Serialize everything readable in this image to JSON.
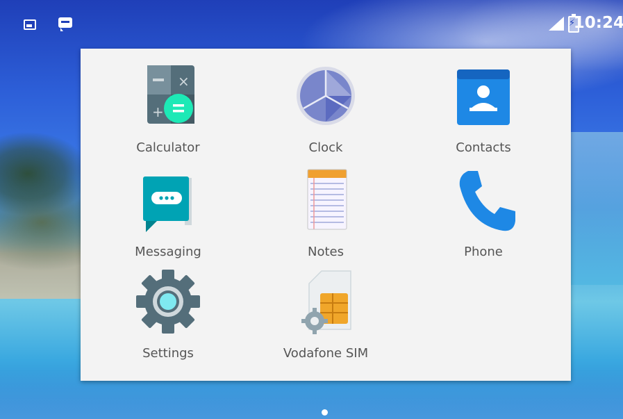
{
  "status_bar": {
    "time": "10:24",
    "icons": [
      "image-notification-icon",
      "message-notification-icon",
      "signal-icon",
      "battery-charging-icon"
    ]
  },
  "folder": {
    "apps": [
      {
        "label": "Calculator",
        "icon": "calculator-icon"
      },
      {
        "label": "Clock",
        "icon": "clock-icon"
      },
      {
        "label": "Contacts",
        "icon": "contacts-icon"
      },
      {
        "label": "Messaging",
        "icon": "messaging-icon"
      },
      {
        "label": "Notes",
        "icon": "notes-icon"
      },
      {
        "label": "Phone",
        "icon": "phone-icon"
      },
      {
        "label": "Settings",
        "icon": "settings-icon"
      },
      {
        "label": "Vodafone SIM",
        "icon": "sim-toolkit-icon"
      }
    ]
  },
  "colors": {
    "accent_teal": "#1de9b6",
    "contacts_blue": "#1e88e5",
    "messaging_teal": "#00a3b4",
    "clock_purple": "#7986cb",
    "settings_gray": "#546e7a"
  },
  "page_indicator": {
    "count": 1,
    "active": 1
  }
}
